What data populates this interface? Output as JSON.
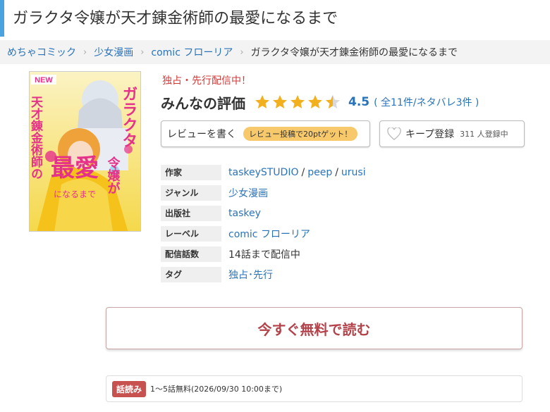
{
  "page": {
    "title": "ガラクタ令嬢が天才錬金術師の最愛になるまで"
  },
  "breadcrumb": [
    {
      "label": "めちゃコミック"
    },
    {
      "label": "少女漫画"
    },
    {
      "label": "comic フローリア"
    },
    {
      "label": "ガラクタ令嬢が天才錬金術師の最愛になるまで"
    }
  ],
  "cover": {
    "badge": "NEW",
    "title_text": "ガラクタ令嬢が天才錬金術師の最愛になるまで",
    "colors": {
      "bg": "#f7e36a",
      "accent": "#e6318b",
      "dress": "#f5c21b"
    }
  },
  "exclusive_label": "独占・先行配信中！",
  "rating": {
    "title": "みんなの評価",
    "value": "4.5",
    "stars": 4.5,
    "count_text": "( 全11件/ネタバレ3件 )",
    "star_color": "#f2b01e"
  },
  "review_button": {
    "label": "レビューを書く",
    "pill": "レビュー投稿で20ptゲット！"
  },
  "keep_button": {
    "label": "キープ登録",
    "count": "311 人登録中"
  },
  "info": {
    "author_key": "作家",
    "authors": [
      "taskeySTUDIO",
      "peep",
      "urusi"
    ],
    "genre_key": "ジャンル",
    "genre": "少女漫画",
    "publisher_key": "出版社",
    "publisher": "taskey",
    "label_key": "レーベル",
    "label": "comic フローリア",
    "episodes_key": "配信話数",
    "episodes": "14話まで配信中",
    "tag_key": "タグ",
    "tag": "独占･先行"
  },
  "read_now_button": "今すぐ無料で読む",
  "free_info": {
    "tag": "話読み",
    "text": "1～5話無料(2026/09/30 10:00まで)"
  },
  "theme": {
    "accent_blue": "#2a73b8",
    "title_border": "#4aa3df",
    "cta_red": "#b3434a"
  }
}
